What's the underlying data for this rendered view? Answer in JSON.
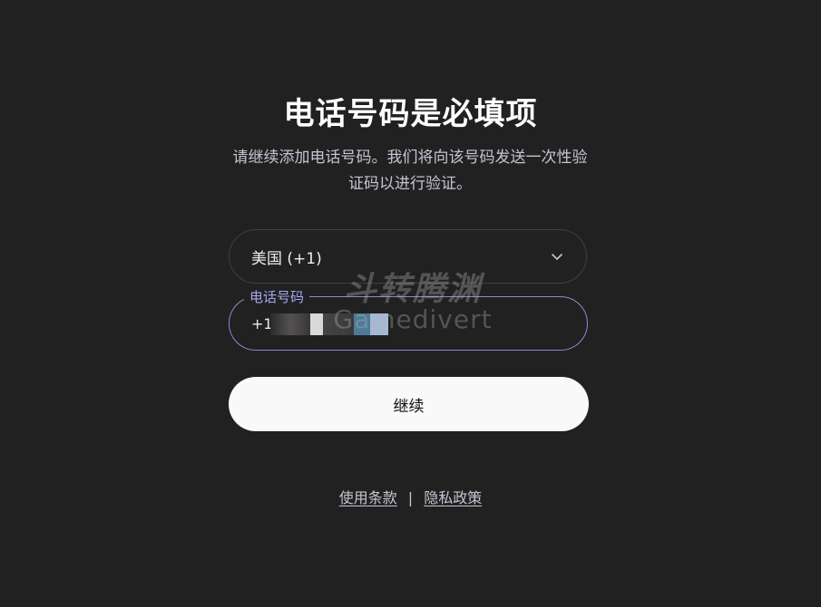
{
  "heading": "电话号码是必填项",
  "description": "请继续添加电话号码。我们将向该号码发送一次性验证码以进行验证。",
  "country_select": {
    "value": "美国 (+1)",
    "icon": "chevron-down-icon"
  },
  "phone_field": {
    "label": "电话号码",
    "prefix": "+1",
    "value": ""
  },
  "watermark": {
    "line1": "斗转腾渊",
    "line2": "Gamedivert"
  },
  "continue_button": "继续",
  "footer": {
    "terms": "使用条款",
    "separator": "|",
    "privacy": "隐私政策"
  },
  "colors": {
    "background": "#212121",
    "accent_border": "#8b8ad6",
    "accent_label": "#a7a6f0",
    "button_bg": "#f9f9f9"
  }
}
